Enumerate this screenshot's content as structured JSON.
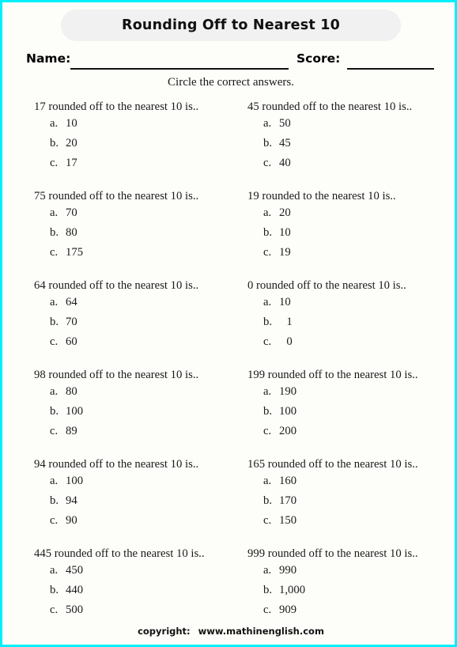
{
  "theme": {
    "border_color": "#00f0fb",
    "page_background": "#fdfdfa",
    "banner_color": "#f1f1f1",
    "text_color": "#1a1a1a"
  },
  "header": {
    "title": "Rounding Off to Nearest 10",
    "name_label": "Name:",
    "score_label": "Score:",
    "instruction": "Circle the correct answers."
  },
  "columns": {
    "left": [
      {
        "stem": "17 rounded off to the nearest 10 is..",
        "options": [
          {
            "letter": "a.",
            "value": "10"
          },
          {
            "letter": "b.",
            "value": "20"
          },
          {
            "letter": "c.",
            "value": "17"
          }
        ]
      },
      {
        "stem": "75 rounded off to the nearest 10 is..",
        "options": [
          {
            "letter": "a.",
            "value": "70"
          },
          {
            "letter": "b.",
            "value": "80"
          },
          {
            "letter": "c.",
            "value": "175"
          }
        ]
      },
      {
        "stem": "64 rounded off to the nearest 10 is..",
        "options": [
          {
            "letter": "a.",
            "value": "64"
          },
          {
            "letter": "b.",
            "value": "70"
          },
          {
            "letter": "c.",
            "value": "60"
          }
        ]
      },
      {
        "stem": "98 rounded off to the nearest 10 is..",
        "options": [
          {
            "letter": "a.",
            "value": "80"
          },
          {
            "letter": "b.",
            "value": "100"
          },
          {
            "letter": "c.",
            "value": "89"
          }
        ]
      },
      {
        "stem": "94 rounded off to the nearest 10 is..",
        "options": [
          {
            "letter": "a.",
            "value": "100"
          },
          {
            "letter": "b.",
            "value": "94"
          },
          {
            "letter": "c.",
            "value": "90"
          }
        ]
      },
      {
        "stem": "445 rounded off to the nearest 10 is..",
        "options": [
          {
            "letter": "a.",
            "value": "450"
          },
          {
            "letter": "b.",
            "value": "440"
          },
          {
            "letter": "c.",
            "value": "500"
          }
        ]
      }
    ],
    "right": [
      {
        "stem": "45 rounded off to the nearest 10 is..",
        "options": [
          {
            "letter": "a.",
            "value": "50"
          },
          {
            "letter": "b.",
            "value": "45"
          },
          {
            "letter": "c.",
            "value": "40"
          }
        ]
      },
      {
        "stem": "19 rounded to the nearest 10 is..",
        "options": [
          {
            "letter": "a.",
            "value": "20"
          },
          {
            "letter": "b.",
            "value": "10"
          },
          {
            "letter": "c.",
            "value": "19"
          }
        ]
      },
      {
        "stem": "0 rounded off to the nearest 10 is..",
        "options": [
          {
            "letter": "a.",
            "value": "10"
          },
          {
            "letter": "b.",
            "value": "1",
            "narrow": true
          },
          {
            "letter": "c.",
            "value": "0",
            "narrow": true
          }
        ]
      },
      {
        "stem": "199 rounded off to the nearest 10 is..",
        "options": [
          {
            "letter": "a.",
            "value": "190"
          },
          {
            "letter": "b.",
            "value": "100"
          },
          {
            "letter": "c.",
            "value": "200"
          }
        ]
      },
      {
        "stem": "165 rounded off to the nearest 10 is..",
        "options": [
          {
            "letter": "a.",
            "value": "160"
          },
          {
            "letter": "b.",
            "value": "170"
          },
          {
            "letter": "c.",
            "value": "150"
          }
        ]
      },
      {
        "stem": "999 rounded off to the nearest 10 is..",
        "options": [
          {
            "letter": "a.",
            "value": "990"
          },
          {
            "letter": "b.",
            "value": "1,000"
          },
          {
            "letter": "c.",
            "value": "909"
          }
        ]
      }
    ]
  },
  "footer": {
    "copyright_label": "copyright:",
    "site": "www.mathinenglish.com"
  }
}
